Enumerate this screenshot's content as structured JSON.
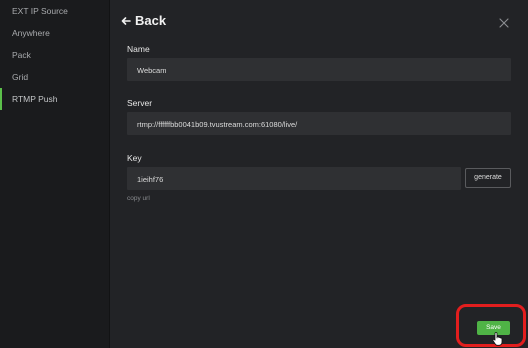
{
  "sidebar": {
    "items": [
      {
        "label": "EXT IP Source"
      },
      {
        "label": "Anywhere"
      },
      {
        "label": "Pack"
      },
      {
        "label": "Grid"
      },
      {
        "label": "RTMP Push"
      }
    ],
    "active_index": 4
  },
  "header": {
    "back_label": "Back",
    "close_icon": "close-icon"
  },
  "form": {
    "name_label": "Name",
    "name_value": "Webcam",
    "server_label": "Server",
    "server_value": "rtmp://ffffffbb0041b09.tvustream.com:61080/live/",
    "key_label": "Key",
    "key_value": "1ieihf76",
    "generate_label": "generate",
    "copy_url_label": "copy url"
  },
  "footer": {
    "save_label": "Save"
  },
  "colors": {
    "accent": "#4fb346",
    "highlight": "#e21e1e",
    "panel": "#222326",
    "field": "#2f3033"
  }
}
